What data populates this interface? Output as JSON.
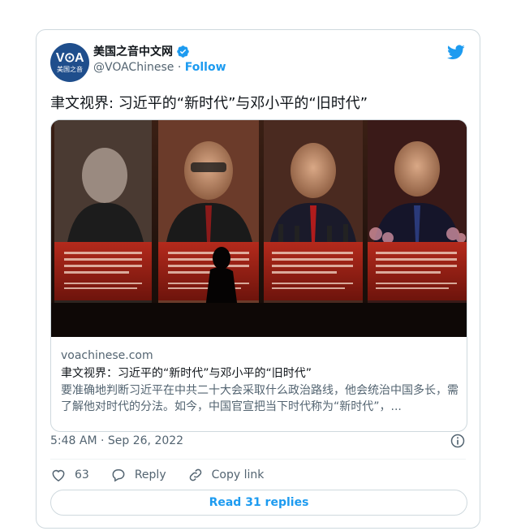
{
  "author": {
    "display_name": "美国之音中文网",
    "handle": "@VOAChinese",
    "separator": "·",
    "follow_label": "Follow",
    "avatar_mark": "V⊙A",
    "avatar_sub": "美国之音"
  },
  "tweet": {
    "text": "聿文视界: 习近平的“新时代”与邓小平的“旧时代”"
  },
  "link_card": {
    "domain": "voachinese.com",
    "title": "聿文视界：习近平的“新时代”与邓小平的“旧时代”",
    "description": "要准确地判断习近平在中共二十大会采取什么政治路线，他会统治中国多长，需了解他对时代的分法。如今，中国官宣把当下时代称为“新时代”，..."
  },
  "meta": {
    "timestamp": "5:48 AM · Sep 26, 2022"
  },
  "actions": {
    "like_count": "63",
    "reply_label": "Reply",
    "copy_label": "Copy link"
  },
  "replies_button": "Read 31 replies",
  "colors": {
    "accent": "#1d9bf0",
    "secondary_text": "#536471",
    "border": "#cfd9de",
    "avatar_bg": "#1f4e8c"
  },
  "icons": [
    "verified-badge-icon",
    "twitter-bird-icon",
    "info-icon",
    "heart-icon",
    "reply-icon",
    "link-icon"
  ]
}
